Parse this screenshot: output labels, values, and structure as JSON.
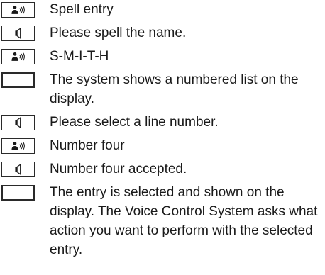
{
  "dialog": {
    "steps": [
      {
        "speaker": "user",
        "icon": "speaking-person-icon",
        "text": "Spell entry"
      },
      {
        "speaker": "system",
        "icon": "speaker-icon",
        "text": "Please spell the name."
      },
      {
        "speaker": "user",
        "icon": "speaking-person-icon",
        "text": "S-M-I-T-H"
      },
      {
        "speaker": "display",
        "icon": "display-screen-icon",
        "text": "The system shows a numbered list on the display."
      },
      {
        "speaker": "system",
        "icon": "speaker-icon",
        "text": "Please select a line number."
      },
      {
        "speaker": "user",
        "icon": "speaking-person-icon",
        "text": "Number four"
      },
      {
        "speaker": "system",
        "icon": "speaker-icon",
        "text": "Number four accepted."
      },
      {
        "speaker": "display",
        "icon": "display-screen-icon",
        "text": "The entry is selected and shown on the display. The Voice Control System asks what action you want to perform with the selected entry."
      }
    ]
  }
}
